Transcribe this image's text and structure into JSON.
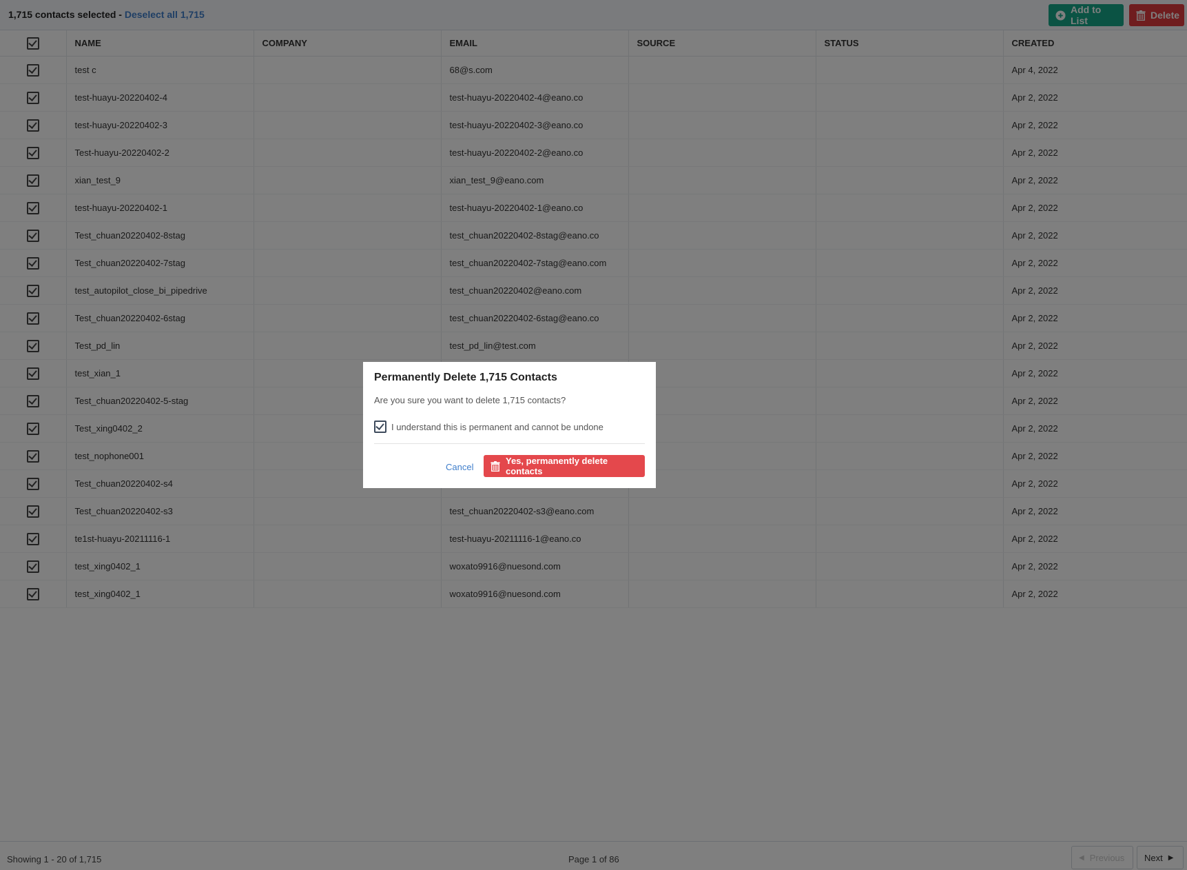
{
  "selection": {
    "count_text": "1,715 contacts selected - ",
    "deselect_link": "Deselect all 1,715"
  },
  "toolbar": {
    "add_to_list": "Add to List",
    "delete": "Delete",
    "add_color": "#17a789",
    "delete_color": "#df3b3f"
  },
  "columns": [
    "NAME",
    "COMPANY",
    "EMAIL",
    "SOURCE",
    "STATUS",
    "CREATED"
  ],
  "rows": [
    {
      "name": "test c",
      "company": "",
      "email": "68@s.com",
      "source": "",
      "status": "",
      "created": "Apr 4, 2022"
    },
    {
      "name": "test-huayu-20220402-4",
      "company": "",
      "email": "test-huayu-20220402-4@eano.co",
      "source": "",
      "status": "",
      "created": "Apr 2, 2022"
    },
    {
      "name": "test-huayu-20220402-3",
      "company": "",
      "email": "test-huayu-20220402-3@eano.co",
      "source": "",
      "status": "",
      "created": "Apr 2, 2022"
    },
    {
      "name": "Test-huayu-20220402-2",
      "company": "",
      "email": "test-huayu-20220402-2@eano.co",
      "source": "",
      "status": "",
      "created": "Apr 2, 2022"
    },
    {
      "name": "xian_test_9",
      "company": "",
      "email": "xian_test_9@eano.com",
      "source": "",
      "status": "",
      "created": "Apr 2, 2022"
    },
    {
      "name": "test-huayu-20220402-1",
      "company": "",
      "email": "test-huayu-20220402-1@eano.co",
      "source": "",
      "status": "",
      "created": "Apr 2, 2022"
    },
    {
      "name": "Test_chuan20220402-8stag",
      "company": "",
      "email": "test_chuan20220402-8stag@eano.co",
      "source": "",
      "status": "",
      "created": "Apr 2, 2022"
    },
    {
      "name": "Test_chuan20220402-7stag",
      "company": "",
      "email": "test_chuan20220402-7stag@eano.com",
      "source": "",
      "status": "",
      "created": "Apr 2, 2022"
    },
    {
      "name": "test_autopilot_close_bi_pipedrive",
      "company": "",
      "email": "test_chuan20220402@eano.com",
      "source": "",
      "status": "",
      "created": "Apr 2, 2022"
    },
    {
      "name": "Test_chuan20220402-6stag",
      "company": "",
      "email": "test_chuan20220402-6stag@eano.co",
      "source": "",
      "status": "",
      "created": "Apr 2, 2022"
    },
    {
      "name": "Test_pd_lin",
      "company": "",
      "email": "test_pd_lin@test.com",
      "source": "",
      "status": "",
      "created": "Apr 2, 2022"
    },
    {
      "name": "test_xian_1",
      "company": "",
      "email": "",
      "source": "",
      "status": "",
      "created": "Apr 2, 2022"
    },
    {
      "name": "Test_chuan20220402-5-stag",
      "company": "",
      "email": "",
      "source": "",
      "status": "",
      "created": "Apr 2, 2022"
    },
    {
      "name": "Test_xing0402_2",
      "company": "",
      "email": "",
      "source": "",
      "status": "",
      "created": "Apr 2, 2022"
    },
    {
      "name": "test_nophone001",
      "company": "",
      "email": "",
      "source": "",
      "status": "",
      "created": "Apr 2, 2022"
    },
    {
      "name": "Test_chuan20220402-s4",
      "company": "",
      "email": "",
      "source": "",
      "status": "",
      "created": "Apr 2, 2022"
    },
    {
      "name": "Test_chuan20220402-s3",
      "company": "",
      "email": "test_chuan20220402-s3@eano.com",
      "source": "",
      "status": "",
      "created": "Apr 2, 2022"
    },
    {
      "name": "te1st-huayu-20211116-1",
      "company": "",
      "email": "test-huayu-20211116-1@eano.co",
      "source": "",
      "status": "",
      "created": "Apr 2, 2022"
    },
    {
      "name": "test_xing0402_1",
      "company": "",
      "email": "woxato9916@nuesond.com",
      "source": "",
      "status": "",
      "created": "Apr 2, 2022"
    },
    {
      "name": "test_xing0402_1",
      "company": "",
      "email": "woxato9916@nuesond.com",
      "source": "",
      "status": "",
      "created": "Apr 2, 2022"
    }
  ],
  "footer": {
    "showing": "Showing 1 - 20 of 1,715",
    "page_info": "Page 1 of 86",
    "prev": "Previous",
    "next": "Next"
  },
  "modal": {
    "title": "Permanently Delete 1,715 Contacts",
    "question": "Are you sure you want to delete 1,715 contacts?",
    "acknowledge": "I understand this is permanent and cannot be undone",
    "acknowledge_checked": true,
    "cancel": "Cancel",
    "confirm": "Yes, permanently delete contacts",
    "confirm_color": "#e4484c"
  }
}
